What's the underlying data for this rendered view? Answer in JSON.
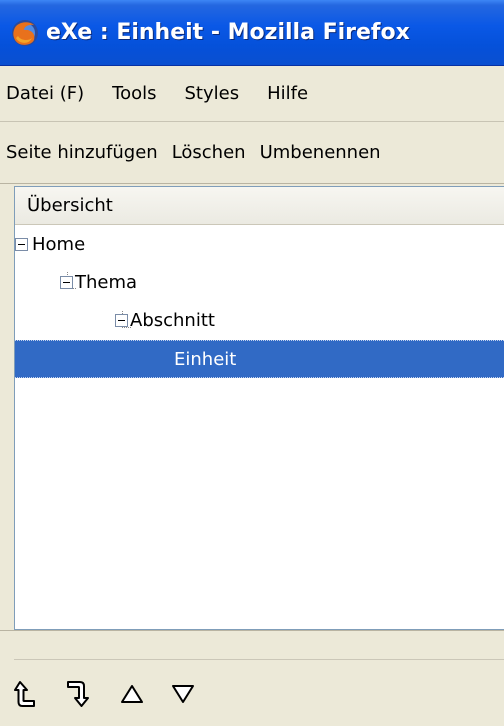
{
  "window": {
    "title": "eXe : Einheit - Mozilla Firefox",
    "icon": "firefox-icon"
  },
  "menubar": {
    "items": [
      {
        "label": "Datei (F)"
      },
      {
        "label": "Tools"
      },
      {
        "label": "Styles"
      },
      {
        "label": "Hilfe"
      }
    ]
  },
  "toolbar": {
    "add_page": "Seite hinzufügen",
    "delete": "Löschen",
    "rename": "Umbenennen"
  },
  "outline": {
    "header": "Übersicht",
    "tree": [
      {
        "label": "Home",
        "level": 0,
        "expanded": true
      },
      {
        "label": "Thema",
        "level": 1,
        "expanded": true
      },
      {
        "label": "Abschnitt",
        "level": 2,
        "expanded": true
      },
      {
        "label": "Einheit",
        "level": 3,
        "selected": true
      }
    ]
  },
  "footer": {
    "buttons": [
      "promote-arrow-icon",
      "demote-arrow-icon",
      "move-up-icon",
      "move-down-icon"
    ]
  },
  "colors": {
    "titlebar": "#0a58e6",
    "selection": "#316ac5",
    "chrome": "#ece9d8"
  }
}
